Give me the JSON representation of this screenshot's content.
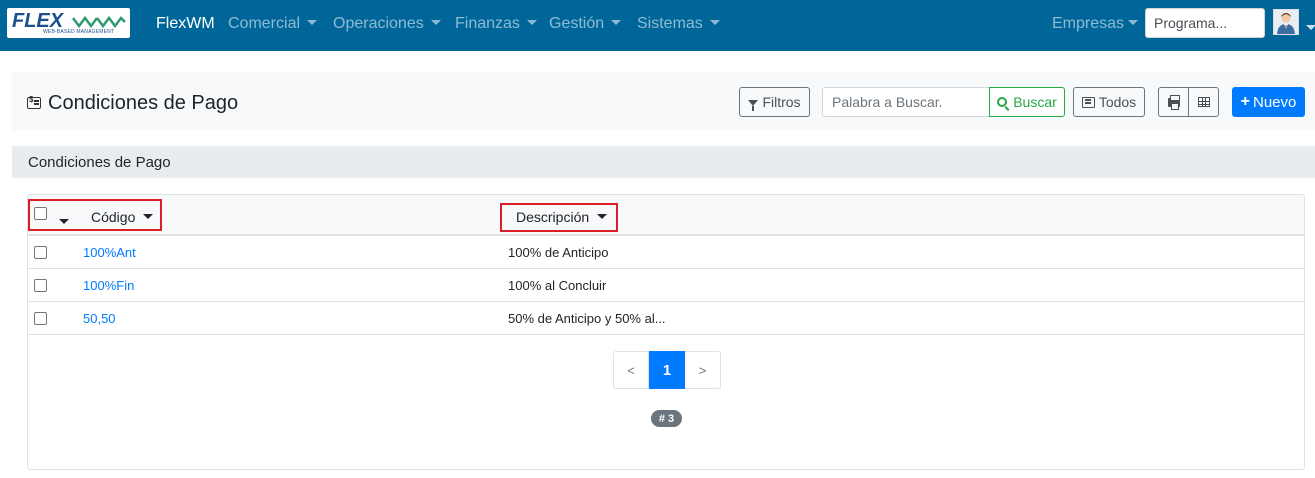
{
  "navbar": {
    "logo": {
      "main": "FLEX",
      "wm": "wm",
      "subtitle": "WEB-BASED MANAGEMENT"
    },
    "brand": "FlexWM",
    "menus": [
      "Comercial",
      "Operaciones",
      "Finanzas",
      "Gestión",
      "Sistemas"
    ],
    "empresas": "Empresas",
    "program_search_placeholder": "Programa..."
  },
  "header": {
    "title": "Condiciones de Pago",
    "filters_label": "Filtros",
    "keyword_placeholder": "Palabra a Buscar.",
    "search_label": "Buscar",
    "all_label": "Todos",
    "new_label": "Nuevo"
  },
  "section": {
    "title": "Condiciones de Pago"
  },
  "table": {
    "columns": {
      "code": "Código",
      "description": "Descripción"
    },
    "rows": [
      {
        "code": "100%Ant",
        "description": "100% de Anticipo"
      },
      {
        "code": "100%Fin",
        "description": "100% al Concluir"
      },
      {
        "code": "50,50",
        "description": "50% de Anticipo y 50% al..."
      }
    ]
  },
  "pagination": {
    "prev": "<",
    "current": "1",
    "next": ">"
  },
  "record_count": "# 3",
  "colors": {
    "navbar": "#006699",
    "primary": "#007bff",
    "success": "#28a745",
    "highlight": "#dc1e28"
  },
  "icons": {
    "title": "money-check-icon",
    "filters": "filter-icon",
    "search": "search-icon",
    "all": "list-icon",
    "print": "print-icon",
    "grid": "table-icon",
    "new": "plus-icon",
    "user": "user-avatar-icon"
  }
}
